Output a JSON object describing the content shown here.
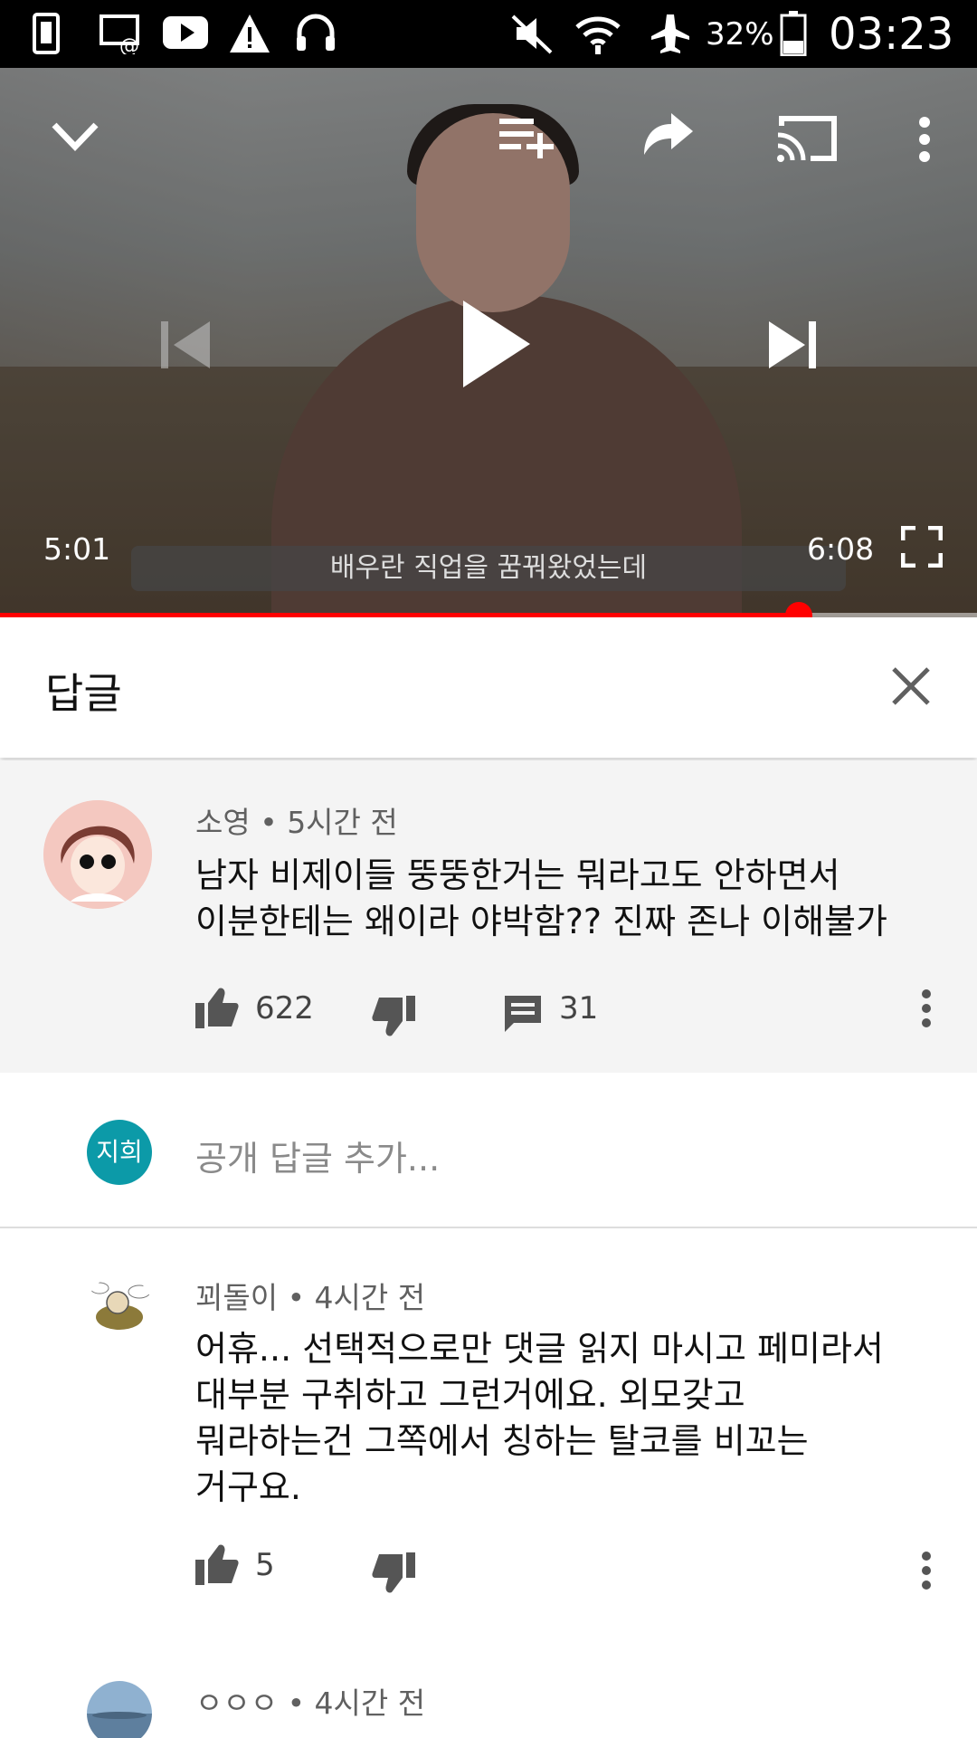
{
  "status_bar": {
    "battery": "32%",
    "time": "03:23",
    "icons": [
      "sim-card-icon",
      "email-cast-icon",
      "youtube-icon",
      "warning-icon",
      "headset-icon",
      "mute-icon",
      "wifi-icon",
      "airplane-icon",
      "battery-icon"
    ]
  },
  "player": {
    "subtitle": "배우란 직업을 꿈꿔왔었는데",
    "time_current": "5:01",
    "time_total": "6:08",
    "progress": 0.818,
    "accent": "#ff0000",
    "controls": [
      "collapse-icon",
      "add-to-queue-icon",
      "share-icon",
      "cast-icon",
      "more-vert-icon",
      "previous-icon",
      "play-icon",
      "next-icon",
      "fullscreen-icon"
    ]
  },
  "replies_panel": {
    "title": "답글"
  },
  "parent_comment": {
    "author": "소영",
    "time": "5시간 전",
    "text_line1": "남자 비제이들 뚱뚱한거는 뭐라고도 안하면서",
    "text_line2": "이분한테는 왜이라 야박함?? 진짜 존나 이해불가",
    "likes": "622",
    "replies": "31"
  },
  "add_reply": {
    "avatar_text": "지희",
    "avatar_color": "#0c9aa8",
    "placeholder": "공개 답글 추가..."
  },
  "replies": [
    {
      "author": "꾀돌이",
      "time": "4시간 전",
      "line1": "어휴... 선택적으로만 댓글 읽지 마시고 페미라서",
      "line2": "대부분 구취하고 그런거에요. 외모갖고",
      "line3": "뭐라하는건 그쪽에서 칭하는 탈코를 비꼬는",
      "line4": "거구요.",
      "likes": "5"
    },
    {
      "author": "ㅇㅇㅇ",
      "time": "4시간 전"
    }
  ]
}
